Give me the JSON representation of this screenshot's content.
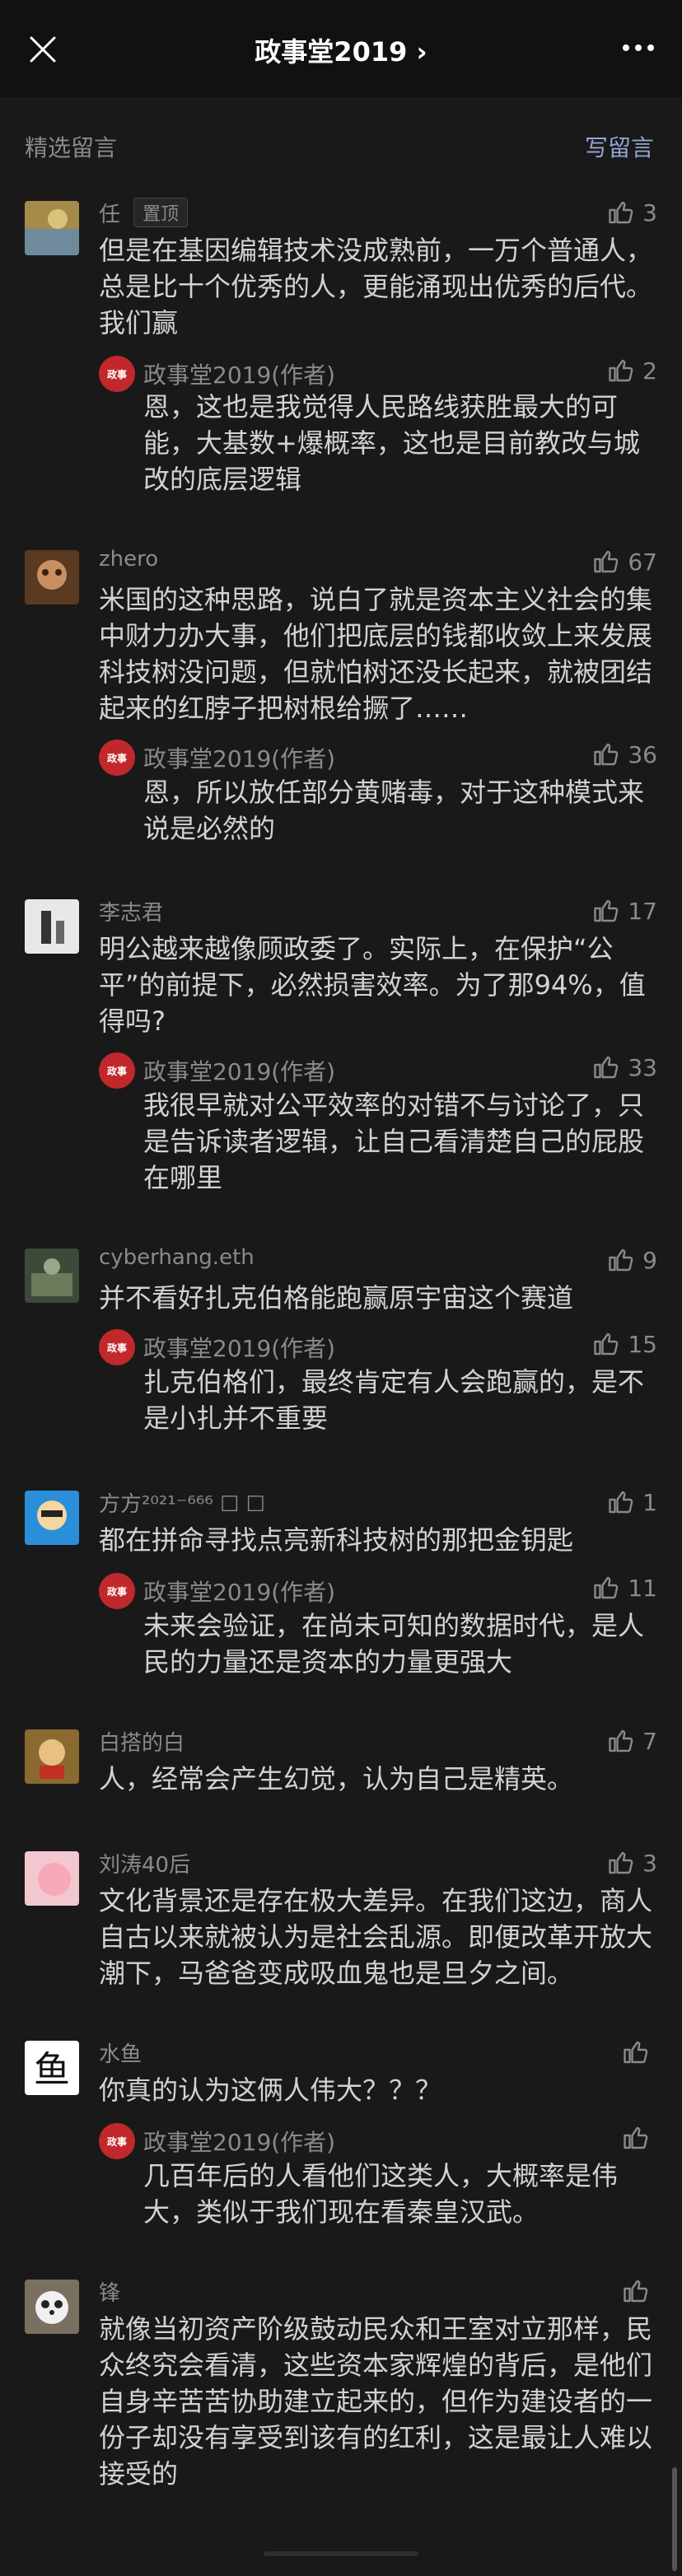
{
  "header": {
    "title": "政事堂2019 ›"
  },
  "section": {
    "label": "精选留言",
    "write_label": "写留言"
  },
  "icons": {
    "close": "close-icon",
    "more": "more-icon",
    "like": "thumbs-up-icon"
  },
  "colors": {
    "background": "#191919",
    "accent_link": "#8fa6d0",
    "author_logo": "#c0282c"
  },
  "comments": [
    {
      "name": "任",
      "pinned_label": "置顶",
      "likes": "3",
      "text": "但是在基因编辑技术没成熟前，一万个普通人，总是比十个优秀的人，更能涌现出优秀的后代。我们赢",
      "reply": {
        "name": "政事堂2019(作者)",
        "likes": "2",
        "text": "恩，这也是我觉得人民路线获胜最大的可能，大基数+爆概率，这也是目前教改与城改的底层逻辑"
      }
    },
    {
      "name": "zhero",
      "likes": "67",
      "text": "米国的这种思路，说白了就是资本主义社会的集中财力办大事，他们把底层的钱都收敛上来发展科技树没问题，但就怕树还没长起来，就被团结起来的红脖子把树根给撅了……",
      "reply": {
        "name": "政事堂2019(作者)",
        "likes": "36",
        "text": "恩，所以放任部分黄赌毒，对于这种模式来说是必然的"
      }
    },
    {
      "name": "李志君",
      "likes": "17",
      "text": "明公越来越像顾政委了。实际上，在保护“公平”的前提下，必然损害效率。为了那94%，值得吗?",
      "reply": {
        "name": "政事堂2019(作者)",
        "likes": "33",
        "text": "我很早就对公平效率的对错不与讨论了，只是告诉读者逻辑，让自己看清楚自己的屁股在哪里"
      }
    },
    {
      "name": "cyberhang.eth",
      "likes": "9",
      "text": "并不看好扎克伯格能跑赢原宇宙这个赛道",
      "reply": {
        "name": "政事堂2019(作者)",
        "likes": "15",
        "text": "扎克伯格们，最终肯定有人会跑赢的，是不是小扎并不重要"
      }
    },
    {
      "name": "方方²⁰²¹⁻⁶⁶⁶ ☐ ☐",
      "likes": "1",
      "text": "都在拼命寻找点亮新科技树的那把金钥匙",
      "reply": {
        "name": "政事堂2019(作者)",
        "likes": "11",
        "text": "未来会验证，在尚未可知的数据时代，是人民的力量还是资本的力量更强大"
      }
    },
    {
      "name": "白搭的白",
      "likes": "7",
      "text": "人，经常会产生幻觉，认为自己是精英。"
    },
    {
      "name": "刘涛40后",
      "likes": "3",
      "text": "文化背景还是存在极大差异。在我们这边，商人自古以来就被认为是社会乱源。即便改革开放大潮下，马爸爸变成吸血鬼也是旦夕之间。"
    },
    {
      "name": "水鱼",
      "likes": "",
      "text": "你真的认为这俩人伟大？？？",
      "reply": {
        "name": "政事堂2019(作者)",
        "likes": "",
        "text": "几百年后的人看他们这类人，大概率是伟大，类似于我们现在看秦皇汉武。"
      }
    },
    {
      "name": "锋",
      "likes": "",
      "text": "就像当初资产阶级鼓动民众和王室对立那样，民众终究会看清，这些资本家辉煌的背后，是他们自身辛苦苦协助建立起来的，但作为建设者的一份子却没有享受到该有的红利，这是最让人难以接受的"
    }
  ]
}
